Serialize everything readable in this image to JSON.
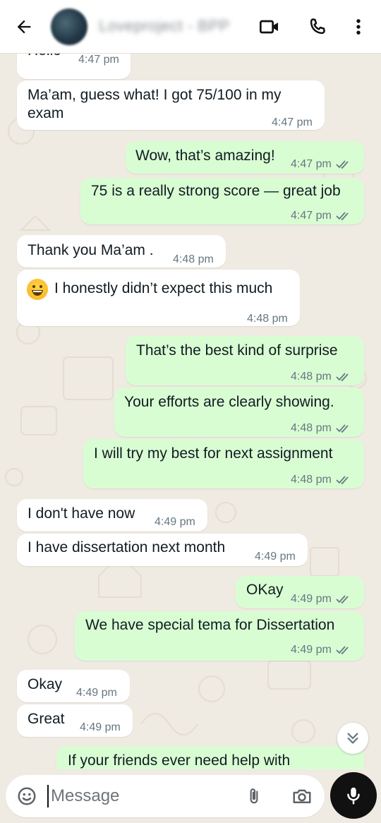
{
  "header": {
    "contact_name": "Loveproject - BPP",
    "icons": [
      "back-arrow-icon",
      "video-call-icon",
      "voice-call-icon",
      "more-vertical-icon"
    ]
  },
  "messages": [
    {
      "dir": "in",
      "text": "Hello",
      "time": "4:47 pm"
    },
    {
      "dir": "in",
      "text": "Ma’am, guess what! I got 75/100 in my",
      "text2": "exam",
      "time": "4:47 pm"
    },
    {
      "dir": "out",
      "text": "Wow, that’s amazing!",
      "time": "4:47 pm"
    },
    {
      "dir": "out",
      "text": "75 is a really strong score — great job",
      "time": "4:47 pm"
    },
    {
      "dir": "in",
      "text": "Thank you Ma’am .",
      "time": "4:48 pm"
    },
    {
      "dir": "in",
      "text": "I honestly didn’t expect this much",
      "emoji": "grinning-face",
      "time": "4:48 pm"
    },
    {
      "dir": "out",
      "text": "That’s the best kind of surprise",
      "time": "4:48 pm"
    },
    {
      "dir": "out",
      "text": "Your efforts are clearly showing.",
      "time": "4:48 pm"
    },
    {
      "dir": "out",
      "text": "I will try my best for next assignment",
      "time": "4:48 pm"
    },
    {
      "dir": "in",
      "text": "I don't have now",
      "time": "4:49 pm"
    },
    {
      "dir": "in",
      "text": "I have dissertation next month",
      "time": "4:49 pm"
    },
    {
      "dir": "out",
      "text": "OKay",
      "time": "4:49 pm"
    },
    {
      "dir": "out",
      "text": "We have special tema for Dissertation",
      "time": "4:49 pm"
    },
    {
      "dir": "in",
      "text": "Okay",
      "time": "4:49 pm"
    },
    {
      "dir": "in",
      "text": "Great",
      "time": "4:49 pm"
    },
    {
      "dir": "out",
      "text": "If your friends ever need help with",
      "time": ""
    }
  ],
  "composer": {
    "placeholder": "Message"
  },
  "colors": {
    "chat_bg": "#efeae2",
    "incoming_bubble": "#ffffff",
    "outgoing_bubble": "#d9fdd3",
    "timestamp": "#667781",
    "mic_button": "#111111"
  }
}
